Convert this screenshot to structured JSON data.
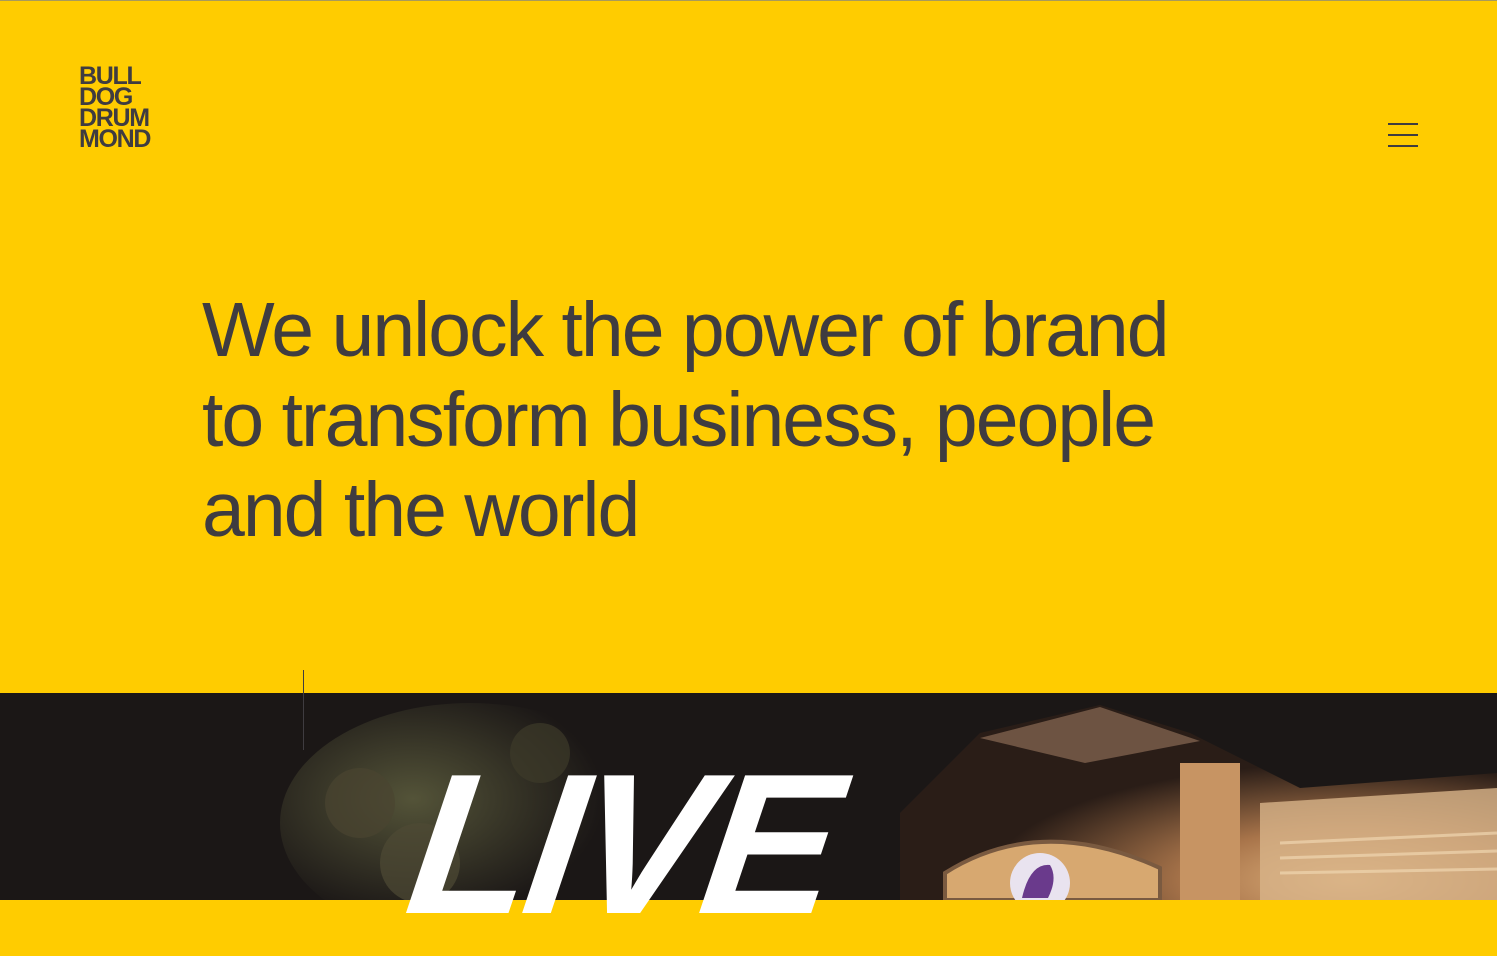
{
  "brand": {
    "logo_lines": [
      "BULL",
      "DOG",
      "DRUM",
      "MOND"
    ]
  },
  "header": {
    "menu_icon": "hamburger-menu-icon"
  },
  "hero": {
    "headline": "We unlock the power of brand to transform business, people and the world"
  },
  "featured": {
    "overlay_text": "LIVE"
  },
  "colors": {
    "background": "#ffcc00",
    "text": "#3f3c40",
    "dark": "#1b1716"
  }
}
